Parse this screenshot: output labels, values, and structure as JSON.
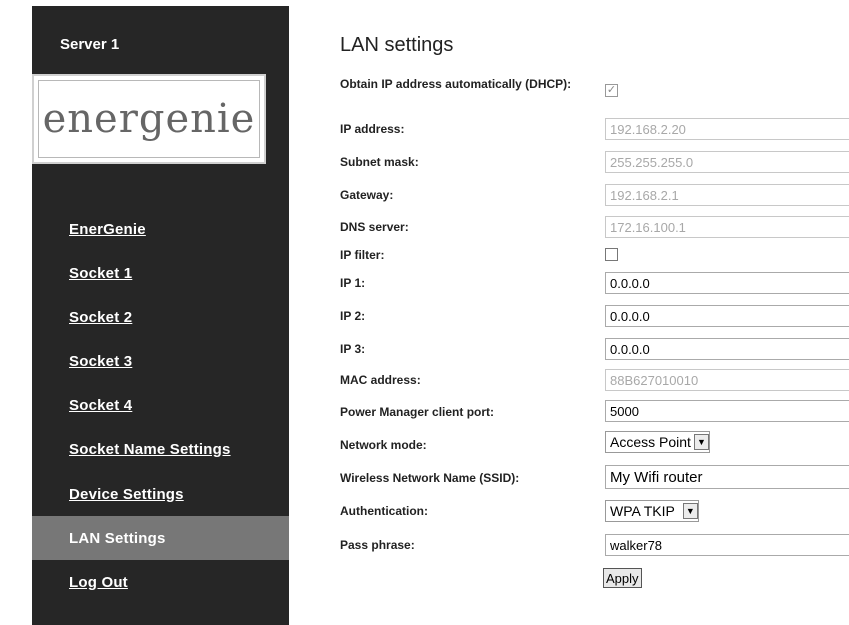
{
  "sidebar": {
    "server_title": "Server 1",
    "logo_text": "energenie",
    "items": [
      {
        "label": "EnerGenie"
      },
      {
        "label": "Socket 1"
      },
      {
        "label": "Socket 2"
      },
      {
        "label": "Socket 3"
      },
      {
        "label": "Socket 4"
      },
      {
        "label": "Socket Name Settings"
      },
      {
        "label": "Device Settings"
      },
      {
        "label": "LAN Settings",
        "active": true
      },
      {
        "label": "Log Out"
      }
    ]
  },
  "main": {
    "title": "LAN settings",
    "fields": {
      "dhcp": {
        "label": "Obtain IP address automatically (DHCP):",
        "checked": true
      },
      "ip_address": {
        "label": "IP address:",
        "value": "192.168.2.20"
      },
      "subnet_mask": {
        "label": "Subnet mask:",
        "value": "255.255.255.0"
      },
      "gateway": {
        "label": "Gateway:",
        "value": "192.168.2.1"
      },
      "dns_server": {
        "label": "DNS server:",
        "value": "172.16.100.1"
      },
      "ip_filter": {
        "label": "IP filter:",
        "checked": false
      },
      "ip1": {
        "label": "IP 1:",
        "value": "0.0.0.0"
      },
      "ip2": {
        "label": "IP 2:",
        "value": "0.0.0.0"
      },
      "ip3": {
        "label": "IP 3:",
        "value": "0.0.0.0"
      },
      "mac_address": {
        "label": "MAC address:",
        "value": "88B627010010"
      },
      "client_port": {
        "label": "Power Manager client port:",
        "value": "5000"
      },
      "network_mode": {
        "label": "Network mode:",
        "value": "Access Point"
      },
      "ssid": {
        "label": "Wireless Network Name (SSID):",
        "value": "My Wifi router"
      },
      "authentication": {
        "label": "Authentication:",
        "value": "WPA TKIP"
      },
      "pass_phrase": {
        "label": "Pass phrase:",
        "value": "walker78"
      }
    },
    "apply_label": "Apply"
  }
}
